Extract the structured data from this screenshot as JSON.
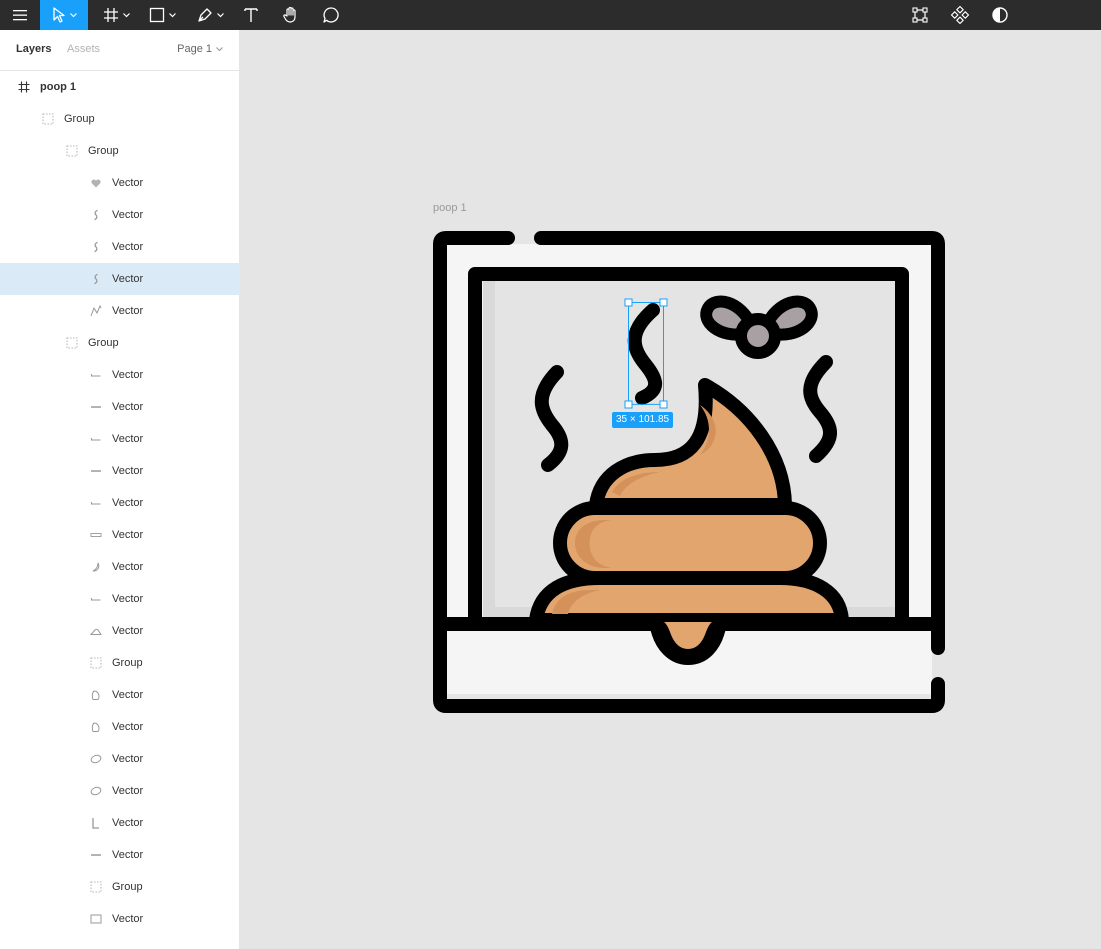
{
  "toolbar": {
    "items": [
      {
        "name": "main-menu",
        "icon": "hamburger-icon"
      },
      {
        "name": "move-tool",
        "icon": "cursor-icon",
        "active": true
      },
      {
        "name": "frame-tool",
        "icon": "hash-icon"
      },
      {
        "name": "shape-tool",
        "icon": "square-icon"
      },
      {
        "name": "pen-tool",
        "icon": "pen-icon"
      },
      {
        "name": "text-tool",
        "icon": "text-icon"
      },
      {
        "name": "hand-tool",
        "icon": "hand-icon"
      },
      {
        "name": "comment-tool",
        "icon": "comment-icon"
      }
    ],
    "right_items": [
      {
        "name": "edit-object",
        "icon": "vector-edit-icon"
      },
      {
        "name": "components",
        "icon": "component-icon"
      },
      {
        "name": "mask",
        "icon": "contrast-icon"
      }
    ],
    "accent": "#18a0fb",
    "background": "#2c2c2c"
  },
  "sidebar": {
    "tabs": {
      "layers": "Layers",
      "assets": "Assets"
    },
    "page": "Page 1",
    "layers": [
      {
        "label": "poop 1",
        "type": "frame",
        "depth": 0
      },
      {
        "label": "Group",
        "type": "group",
        "depth": 1
      },
      {
        "label": "Group",
        "type": "group",
        "depth": 2
      },
      {
        "label": "Vector",
        "type": "vector",
        "depth": 3,
        "glyph": "heart"
      },
      {
        "label": "Vector",
        "type": "vector",
        "depth": 3,
        "glyph": "squiggle"
      },
      {
        "label": "Vector",
        "type": "vector",
        "depth": 3,
        "glyph": "squiggle"
      },
      {
        "label": "Vector",
        "type": "vector",
        "depth": 3,
        "glyph": "squiggle",
        "selected": true
      },
      {
        "label": "Vector",
        "type": "vector",
        "depth": 3,
        "glyph": "wave"
      },
      {
        "label": "Group",
        "type": "group",
        "depth": 2
      },
      {
        "label": "Vector",
        "type": "vector",
        "depth": 3,
        "glyph": "line"
      },
      {
        "label": "Vector",
        "type": "vector",
        "depth": 3,
        "glyph": "bar"
      },
      {
        "label": "Vector",
        "type": "vector",
        "depth": 3,
        "glyph": "line"
      },
      {
        "label": "Vector",
        "type": "vector",
        "depth": 3,
        "glyph": "bar"
      },
      {
        "label": "Vector",
        "type": "vector",
        "depth": 3,
        "glyph": "line"
      },
      {
        "label": "Vector",
        "type": "vector",
        "depth": 3,
        "glyph": "rect-thin"
      },
      {
        "label": "Vector",
        "type": "vector",
        "depth": 3,
        "glyph": "moon"
      },
      {
        "label": "Vector",
        "type": "vector",
        "depth": 3,
        "glyph": "line"
      },
      {
        "label": "Vector",
        "type": "vector",
        "depth": 3,
        "glyph": "mound"
      },
      {
        "label": "Group",
        "type": "group",
        "depth": 3
      },
      {
        "label": "Vector",
        "type": "vector",
        "depth": 3,
        "glyph": "drop"
      },
      {
        "label": "Vector",
        "type": "vector",
        "depth": 3,
        "glyph": "drop"
      },
      {
        "label": "Vector",
        "type": "vector",
        "depth": 3,
        "glyph": "oval"
      },
      {
        "label": "Vector",
        "type": "vector",
        "depth": 3,
        "glyph": "oval"
      },
      {
        "label": "Vector",
        "type": "vector",
        "depth": 3,
        "glyph": "corner"
      },
      {
        "label": "Vector",
        "type": "vector",
        "depth": 3,
        "glyph": "bar"
      },
      {
        "label": "Group",
        "type": "group",
        "depth": 3
      },
      {
        "label": "Vector",
        "type": "vector",
        "depth": 3,
        "glyph": "rect"
      }
    ],
    "selected_color": "#daebf7"
  },
  "canvas": {
    "frame_label": "poop 1",
    "selection_size": "35 × 101.85",
    "colors": {
      "background": "#e5e5e5",
      "outline": "#000000",
      "poop": "#e3a56e",
      "poop_shadow": "#d4915a",
      "panel": "#f5f5f5",
      "panel_inner": "#e1e1e1",
      "fly_wing": "#a8a0a3",
      "selection": "#18a0fb"
    }
  }
}
